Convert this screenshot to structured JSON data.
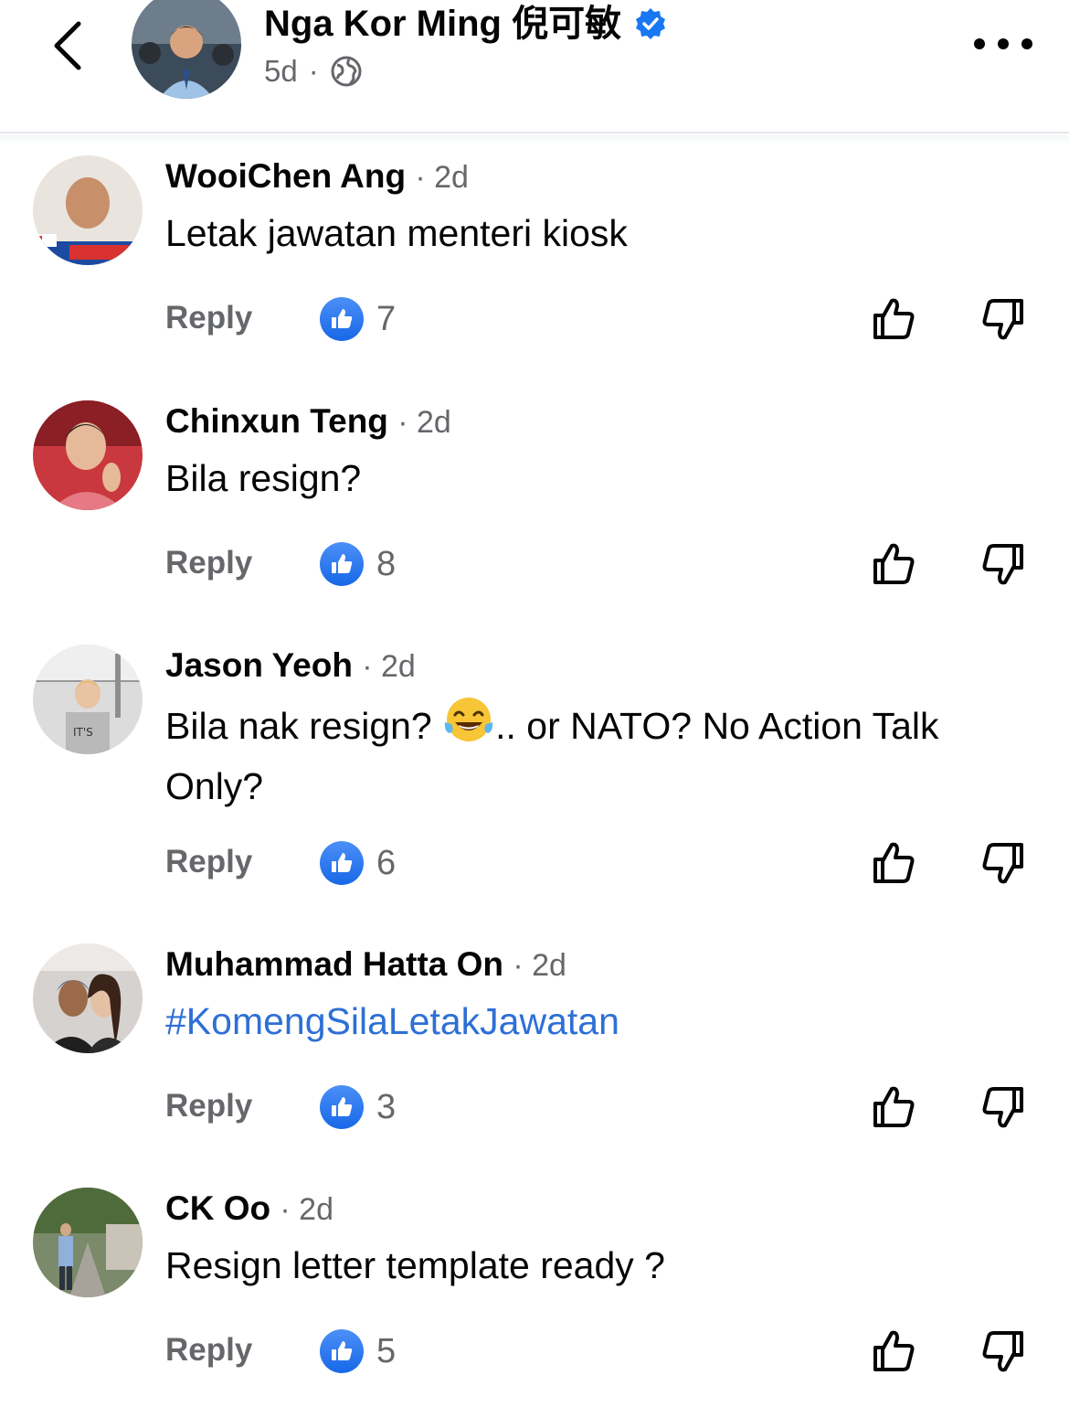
{
  "header": {
    "page_name": "Nga Kor Ming 倪可敏",
    "post_age": "5d",
    "dot": "·"
  },
  "comments": [
    {
      "author": "WooiChen Ang",
      "time": "· 2d",
      "text": "Letak jawatan menteri kiosk",
      "reply_label": "Reply",
      "likes": "7"
    },
    {
      "author": "Chinxun Teng",
      "time": "· 2d",
      "text": "Bila resign?",
      "reply_label": "Reply",
      "likes": "8"
    },
    {
      "author": "Jason Yeoh",
      "time": "· 2d",
      "text_before_emoji": "Bila nak resign? ",
      "text_after_emoji": ".. or NATO? No Action Talk Only?",
      "reply_label": "Reply",
      "likes": "6"
    },
    {
      "author": "Muhammad Hatta On",
      "time": "· 2d",
      "text": "#KomengSilaLetakJawatan",
      "reply_label": "Reply",
      "likes": "3"
    },
    {
      "author": "CK Oo",
      "time": "· 2d",
      "text": "Resign letter template ready ?",
      "reply_label": "Reply",
      "likes": "5"
    }
  ],
  "colors": {
    "like_blue": "#1877f2",
    "secondary_text": "#65676b",
    "hashtag_link": "#2d6fd6"
  }
}
